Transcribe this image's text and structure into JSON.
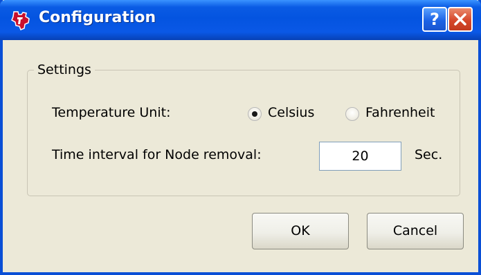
{
  "window": {
    "title": "Configuration",
    "help_label": "?",
    "icons": {
      "app": "ti-logo-icon",
      "help": "help-icon",
      "close": "close-icon"
    }
  },
  "settings": {
    "group_title": "Settings",
    "temperature_label": "Temperature Unit:",
    "options": [
      {
        "label": "Celsius",
        "selected": true
      },
      {
        "label": "Fahrenheit",
        "selected": false
      }
    ],
    "interval_label": "Time interval for Node removal:",
    "interval_value": "20",
    "interval_unit": "Sec."
  },
  "buttons": {
    "ok": "OK",
    "cancel": "Cancel"
  },
  "colors": {
    "titlebar": "#0454e0",
    "dialog_bg": "#ece9d8",
    "close": "#d6472b"
  }
}
